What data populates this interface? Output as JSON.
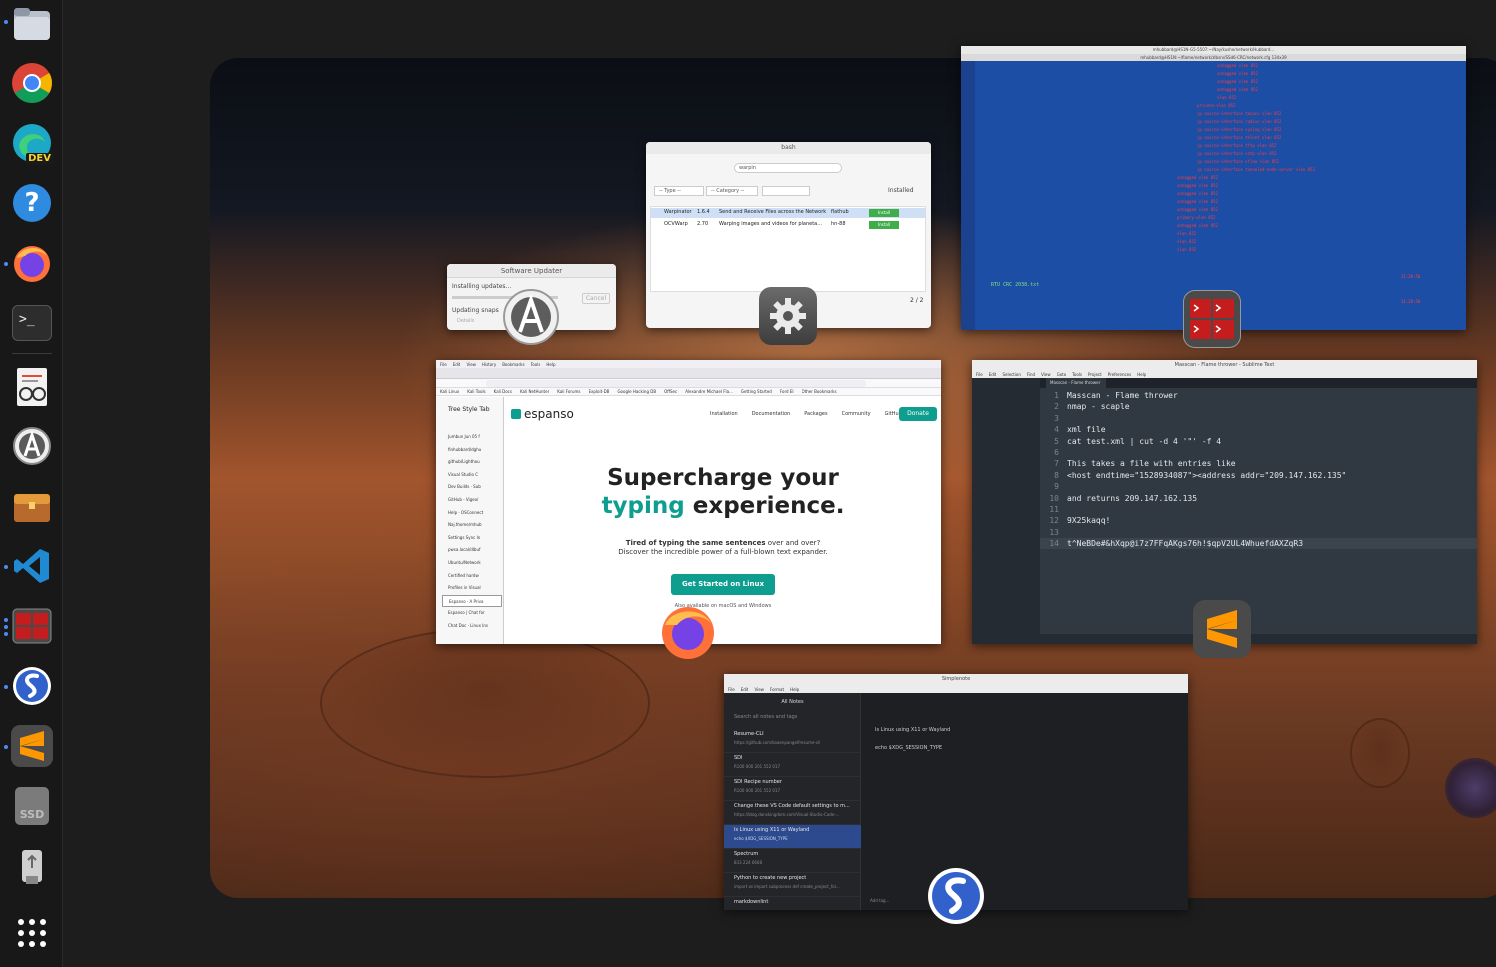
{
  "dock": {
    "items": [
      {
        "icon": "files-icon"
      },
      {
        "icon": "chrome-icon"
      },
      {
        "icon": "edge-dev-icon",
        "badge": "DEV"
      },
      {
        "icon": "help-icon",
        "glyph": "?"
      },
      {
        "icon": "firefox-icon"
      },
      {
        "icon": "terminal-icon",
        "glyph": ">_"
      },
      {
        "icon": "document-viewer-icon"
      },
      {
        "icon": "software-updater-icon"
      },
      {
        "icon": "toolbox-icon"
      },
      {
        "icon": "vscode-icon"
      },
      {
        "icon": "terminator-icon"
      },
      {
        "icon": "simplenote-icon"
      },
      {
        "icon": "sublime-text-icon"
      },
      {
        "icon": "ssd-drive-icon",
        "label": "SSD"
      },
      {
        "icon": "usb-drive-icon"
      },
      {
        "icon": "app-grid-icon"
      }
    ]
  },
  "software_updater": {
    "title": "Software Updater",
    "status": "Installing updates...",
    "cancel": "Cancel",
    "detail": "Updating snaps",
    "details_link": "Details"
  },
  "flatpak_window": {
    "title": "bash",
    "search": "warpin",
    "type_filter": "-- Type --",
    "category_filter": "-- Category --",
    "installed": "Installed",
    "rows": [
      {
        "name": "Warpinator",
        "version": "1.6.4",
        "desc": "Send and Receive Files across the Network",
        "source": "flathub",
        "action": "Install"
      },
      {
        "name": "OCVWarp",
        "version": "2.70",
        "desc": "Warping images and videos for planeta...",
        "source": "hn-88",
        "action": "Install"
      }
    ],
    "count": "2 / 2"
  },
  "terminal_window": {
    "title": "mhubbard@HS1N-G5-5507:~/Nay/kushe/network/Hubbard...",
    "tab_title": "mhubbard@HS1N:~/flame/network/zlbsrv/SSd6-CRC/network.cfg 134x39",
    "lines": [
      "untagged vlan 852",
      "untagged vlan 852",
      "untagged vlan 852",
      "untagged vlan 852",
      "vlan 852",
      "private-vlan 852",
      "ip source-interface tacacs vlan 852",
      "ip source-interface radius vlan 852",
      "ip source-interface syslog vlan 852",
      "ip source-interface telnet vlan 852",
      "ip source-interface tftp vlan 852",
      "ip source-interface sntp vlan 852",
      "ip source-interface sflow vlan 852",
      "ip source-interface tunneled-node-server vlan 852",
      "untagged vlan 852",
      "untagged vlan 852",
      "untagged vlan 852",
      "untagged vlan 852",
      "untagged vlan 852",
      "primary-vlan 852",
      "untagged vlan 852",
      "vlan 852",
      "vlan 852",
      "vlan 852"
    ],
    "prompt_lines": [
      "RTU CRC 2038.txt",
      "11:20:50",
      "11:20:50"
    ]
  },
  "firefox_window": {
    "menu": [
      "File",
      "Edit",
      "View",
      "History",
      "Bookmarks",
      "Tools",
      "Help"
    ],
    "sidebar_title": "Tree Style Tab",
    "tabs": [
      "Jumbun Jun 05 f",
      "finhubbard/dghu",
      "github/Lighthou",
      "Visual Studio C",
      "Dev Builds · Sub",
      "GitHub - Vigeo/",
      "Help · OSConnect",
      "Naj.thome/mhub",
      "Settings Sync In",
      "pwsa.local/dlbuf",
      "Ubuntu/Network",
      "Certified hardw",
      "Profiles in Visual",
      "Espanso · A Priva",
      "Espanso | Chat for",
      "Chat Doc · Linux Ins"
    ],
    "bookmarks": [
      "Kali Linux",
      "Kali Tools",
      "Kali Docs",
      "Kali NetHunter",
      "Kali Forums",
      "Exploit-DB",
      "Google Hacking DB",
      "OffSec",
      "Alexandre Michael Fla...",
      "Getting Started",
      "Ford EI",
      "Other Bookmarks"
    ],
    "logo": "espanso",
    "nav": [
      "Installation",
      "Documentation",
      "Packages",
      "Community",
      "GitHub"
    ],
    "donate": "Donate",
    "heading1": "Supercharge your",
    "heading2_accent": "typing",
    "heading2_rest": " experience.",
    "sub_bold": "Tired of typing the same sentences",
    "sub_rest": " over and over?",
    "sub2": "Discover the incredible power of a full-blown text expander.",
    "cta": "Get Started on Linux",
    "also": "Also available on macOS and Windows"
  },
  "sublime_window": {
    "title": "Masscan - Flame thrower - Sublime Text",
    "menu": [
      "File",
      "Edit",
      "Selection",
      "Find",
      "View",
      "Goto",
      "Tools",
      "Project",
      "Preferences",
      "Help"
    ],
    "tab": "Masscan - Flame thrower",
    "lines": [
      {
        "n": "1",
        "t": "Masscan - Flame thrower"
      },
      {
        "n": "2",
        "t": "nmap - scaple"
      },
      {
        "n": "3",
        "t": ""
      },
      {
        "n": "4",
        "t": "xml file"
      },
      {
        "n": "5",
        "t": "cat test.xml | cut -d 4 '\"' -f 4"
      },
      {
        "n": "6",
        "t": ""
      },
      {
        "n": "7",
        "t": "This takes a file with entries like"
      },
      {
        "n": "8",
        "t": "<host endtime=\"1528934087\"><address addr=\"209.147.162.135\""
      },
      {
        "n": "9",
        "t": ""
      },
      {
        "n": "10",
        "t": "and returns 209.147.162.135"
      },
      {
        "n": "11",
        "t": ""
      },
      {
        "n": "12",
        "t": "9X25kaqq!"
      },
      {
        "n": "13",
        "t": ""
      },
      {
        "n": "14",
        "t": "t^NeBDe#&hXqp@i7z7FFqAKgs76h!$qpV2UL4WhuefdAXZqR3"
      }
    ]
  },
  "simplenote_window": {
    "title": "Simplenote",
    "menu": [
      "File",
      "Edit",
      "View",
      "Format",
      "Help"
    ],
    "header": "All Notes",
    "search": "Search all notes and tags",
    "notes": [
      {
        "title": "Resume-CLI",
        "preview": "https://github.com/koaenpangelfresume-cli"
      },
      {
        "title": "SDI",
        "preview": "R100 000 201 552 017"
      },
      {
        "title": "SDI Recipe number",
        "preview": "R100 000 201 552 017"
      },
      {
        "title": "Change these VS Code default settings to m...",
        "preview": "https://blog.danskingdom.com/Visual-Studio-Code-..."
      },
      {
        "title": "Is Linux using X11 or Wayland",
        "preview": "echo $XDG_SESSION_TYPE"
      },
      {
        "title": "Spectrum",
        "preview": "833 224 6608"
      },
      {
        "title": "Python to create new project",
        "preview": "import os import subprocess def create_project_fol..."
      },
      {
        "title": "markdownlint",
        "preview": ""
      }
    ],
    "editor_line1": "Is Linux using X11 or Wayland",
    "editor_line2": "echo $XDG_SESSION_TYPE",
    "add_tag": "Add tag..."
  },
  "colors": {
    "accent": "#4c8bf5",
    "espanso_teal": "#0e9e8f",
    "sublime_orange": "#ff9800",
    "terminal_blue": "#1e4fa8",
    "simplenote_blue": "#3361cc"
  }
}
